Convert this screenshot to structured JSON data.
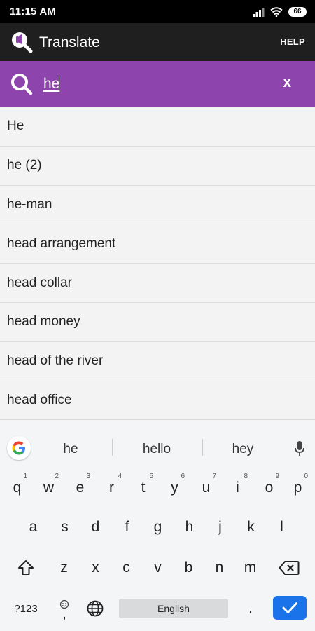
{
  "status_bar": {
    "time": "11:15 AM",
    "battery": "66"
  },
  "app_bar": {
    "title": "Translate",
    "help_label": "HELP"
  },
  "search": {
    "query": "he",
    "clear_label": "x"
  },
  "results": [
    "He",
    "he (2)",
    "he-man",
    "head arrangement",
    "head collar",
    "head money",
    "head of the river",
    "head office"
  ],
  "keyboard": {
    "suggestions": [
      "he",
      "hello",
      "hey"
    ],
    "row1": [
      {
        "key": "q",
        "hint": "1"
      },
      {
        "key": "w",
        "hint": "2"
      },
      {
        "key": "e",
        "hint": "3"
      },
      {
        "key": "r",
        "hint": "4"
      },
      {
        "key": "t",
        "hint": "5"
      },
      {
        "key": "y",
        "hint": "6"
      },
      {
        "key": "u",
        "hint": "7"
      },
      {
        "key": "i",
        "hint": "8"
      },
      {
        "key": "o",
        "hint": "9"
      },
      {
        "key": "p",
        "hint": "0"
      }
    ],
    "row2": [
      "a",
      "s",
      "d",
      "f",
      "g",
      "h",
      "j",
      "k",
      "l"
    ],
    "row3": [
      "z",
      "x",
      "c",
      "v",
      "b",
      "n",
      "m"
    ],
    "symbols_label": "?123",
    "comma_label": ",",
    "space_label": "English",
    "period_label": "."
  },
  "colors": {
    "accent": "#8e44ad",
    "app_bar": "#1f1f1f",
    "enter": "#1a73e8"
  }
}
